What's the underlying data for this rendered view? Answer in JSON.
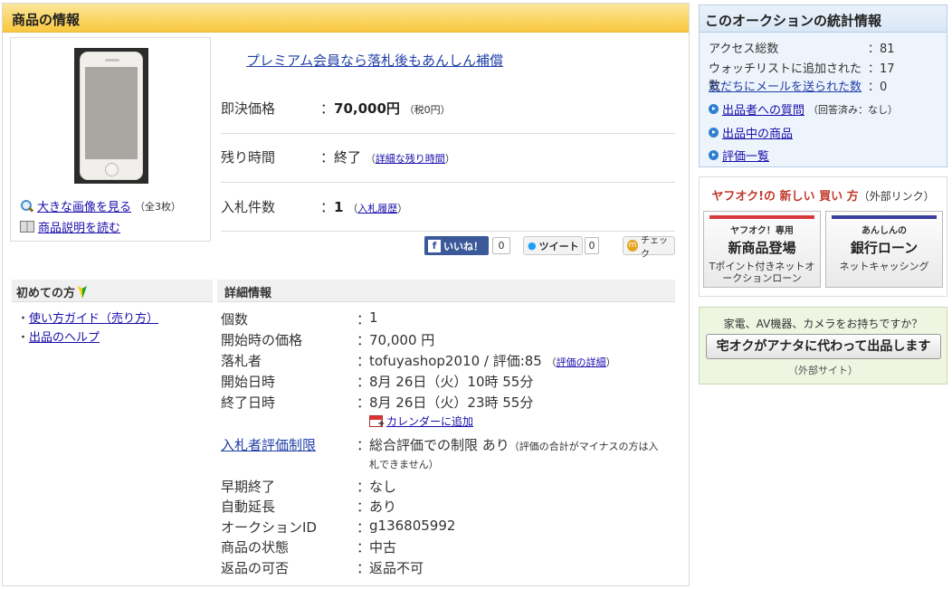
{
  "main": {
    "header": "商品の情報",
    "premium_link": "プレミアム会員なら落札後もあんしん補償",
    "image_links": {
      "large_label": "大きな画像を見る",
      "large_count": "（全3枚）",
      "desc_label": "商品説明を読む"
    },
    "price": {
      "buyout_label": "即決価格",
      "buyout_value": "70,000円",
      "buyout_tax": "（税0円）",
      "remaining_label": "残り時間",
      "remaining_value": "終了",
      "remaining_link": "詳細な残り時間",
      "bids_label": "入札件数",
      "bids_value": "1",
      "bids_link": "入札履歴"
    },
    "social": {
      "like": "いいね！",
      "like_count": "0",
      "tweet": "ツイート",
      "tweet_count": "0",
      "check": "チェック"
    },
    "beginner": {
      "title": "初めての方",
      "items": [
        "使い方ガイド（売り方）",
        "出品のヘルプ"
      ]
    },
    "details": {
      "title": "詳細情報",
      "qty_k": "個数",
      "qty_v": "1",
      "start_price_k": "開始時の価格",
      "start_price_v": "70,000 円",
      "winner_k": "落札者",
      "winner_v": "tofuyashop2010 / 評価:85",
      "winner_link": "評価の詳細",
      "start_k": "開始日時",
      "start_v": "8月 26日（火）10時 55分",
      "end_k": "終了日時",
      "end_v": "8月 26日（火）23時 55分",
      "calendar_link": "カレンダーに追加",
      "limit_k": "入札者評価制限",
      "limit_v": "総合評価での制限 あり",
      "limit_note1": "（評価の合計がマイナスの方は入",
      "limit_note2": "札できません）",
      "early_k": "早期終了",
      "early_v": "なし",
      "extend_k": "自動延長",
      "extend_v": "あり",
      "id_k": "オークションID",
      "id_v": "g136805992",
      "cond_k": "商品の状態",
      "cond_v": "中古",
      "return_k": "返品の可否",
      "return_v": "返品不可"
    }
  },
  "stats": {
    "title": "このオークションの統計情報",
    "access_k": "アクセス総数",
    "access_v": "：81",
    "watch_k": "ウォッチリストに追加された数",
    "watch_v": "：17",
    "mail_k": "友だちにメールを送られた数",
    "mail_v": "：0",
    "question_link": "出品者への質問",
    "question_note": "（回答済み：なし）",
    "listing_link": "出品中の商品",
    "rating_link": "評価一覧"
  },
  "newbuy": {
    "title": "ヤフオク!の 新しい 買い 方",
    "ext": "（外部リンク）",
    "btn1_t1": "ヤフオク！専用",
    "btn1_t2": "新商品登場",
    "btn1_t3": "Tポイント付きネットオークションローン",
    "btn2_t1": "あんしんの",
    "btn2_t2": "銀行ローン",
    "btn2_t3": "ネットキャッシング"
  },
  "takuoku": {
    "question": "家電、AV機器、カメラをお持ちですか？",
    "button": "宅オクがアナタに代わって出品します",
    "ext": "（外部サイト）"
  },
  "colors": {
    "header_yellow": "#f9c83e",
    "stats_blue": "#d9e7f6",
    "link": "#1a0dab",
    "fb": "#3b5998"
  }
}
